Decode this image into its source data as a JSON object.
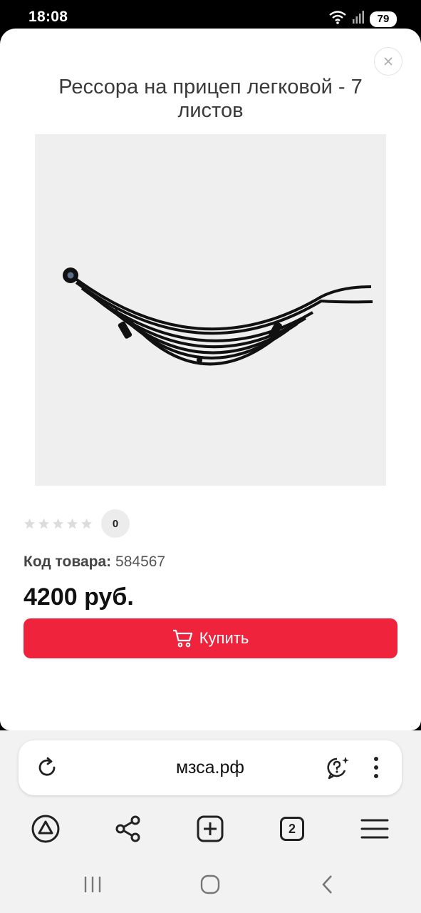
{
  "status_bar": {
    "time": "18:08",
    "battery": "79",
    "icons": [
      "wifi-icon",
      "signal-icon",
      "battery-icon"
    ]
  },
  "product": {
    "title": "Рессора на прицеп легковой - 7 листов",
    "image_alt": "leaf-spring-image",
    "rating_stars": 0,
    "review_count": "0",
    "sku_label": "Код товара:",
    "sku_value": "584567",
    "price": "4200 руб.",
    "buy_label": "Купить"
  },
  "browser": {
    "url": "мзса.рф",
    "tabs_count": "2",
    "toolbar_icons": [
      "alice-icon",
      "share-icon",
      "add-tab-icon",
      "tabs-icon",
      "menu-icon"
    ]
  },
  "colors": {
    "accent": "#ef233c",
    "status_bar_bg": "#000000",
    "browser_bg": "#f2f2f2"
  }
}
